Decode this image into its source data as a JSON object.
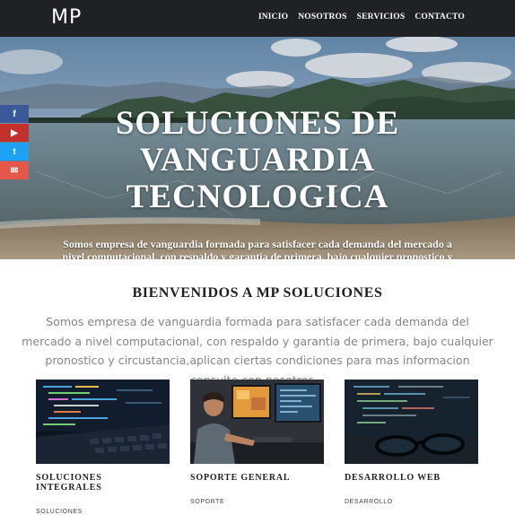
{
  "brand": {
    "logo": "MP"
  },
  "nav": [
    {
      "label": "INICIO"
    },
    {
      "label": "NOSOTROS"
    },
    {
      "label": "SERVICIOS"
    },
    {
      "label": "CONTACTO"
    }
  ],
  "hero": {
    "title_lines": [
      "SOLUCIONES DE",
      "VANGUARDIA",
      "TECNOLOGICA"
    ],
    "subtitle": "Somos empresa de vanguardia formada para satisfacer cada demanda del mercado a nivel computacional, con respaldo y garantia de primera, bajo cualquier pronostico y"
  },
  "social": [
    {
      "icon": "facebook-icon",
      "glyph": "f",
      "color": "#3b5998"
    },
    {
      "icon": "youtube-icon",
      "glyph": "▶",
      "color": "#c4302b"
    },
    {
      "icon": "twitter-icon",
      "glyph": "t",
      "color": "#1da1f2"
    },
    {
      "icon": "mail-icon",
      "glyph": "✉",
      "color": "#e6574b"
    }
  ],
  "welcome": {
    "title": "BIENVENIDOS A MP SOLUCIONES",
    "text": "Somos empresa de vanguardia formada para satisfacer cada demanda del mercado a nivel computacional, con respaldo y garantia de primera, bajo cualquier pronostico y circustancia,aplican ciertas condiciones para mas informacion consulte con nosotros..."
  },
  "cards": [
    {
      "title": "SOLUCIONES INTEGRALES",
      "subtitle": "SOLUCIONES",
      "image": "laptop-code-image"
    },
    {
      "title": "SOPORTE GENERAL",
      "subtitle": "SOPORTE",
      "image": "developer-monitors-image"
    },
    {
      "title": "DESARROLLO WEB",
      "subtitle": "DESARROLLO",
      "image": "code-screen-glasses-image"
    }
  ]
}
